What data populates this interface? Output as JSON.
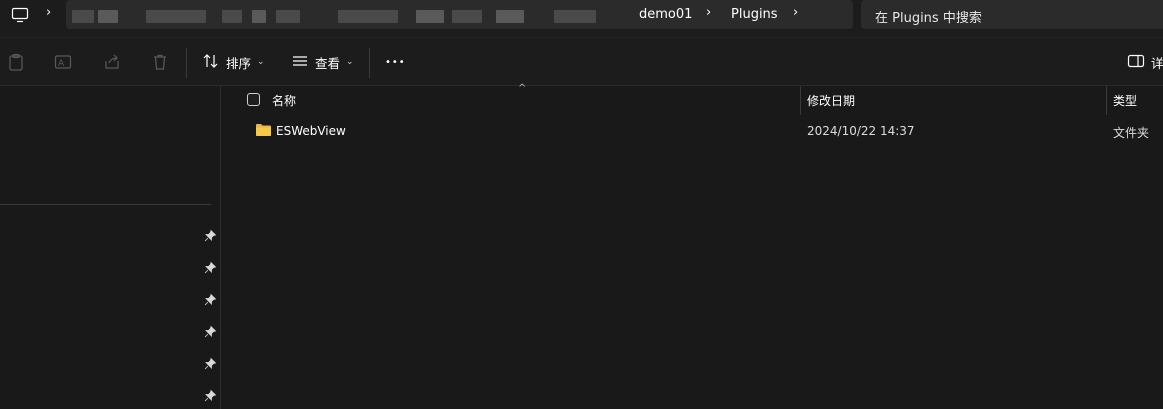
{
  "address_bar": {
    "crumbs": [
      "demo01",
      "Plugins"
    ]
  },
  "search": {
    "placeholder": "在 Plugins 中搜索"
  },
  "toolbar": {
    "sort_label": "排序",
    "view_label": "查看",
    "more_label": "•••",
    "details_label": "详"
  },
  "columns": {
    "name": "名称",
    "date": "修改日期",
    "type": "类型"
  },
  "files": [
    {
      "name": "ESWebView",
      "date": "2024/10/22 14:37",
      "type": "文件夹"
    }
  ],
  "colors": {
    "background": "#191919",
    "panel": "#2b2b2b",
    "folder": "#f7c948"
  }
}
